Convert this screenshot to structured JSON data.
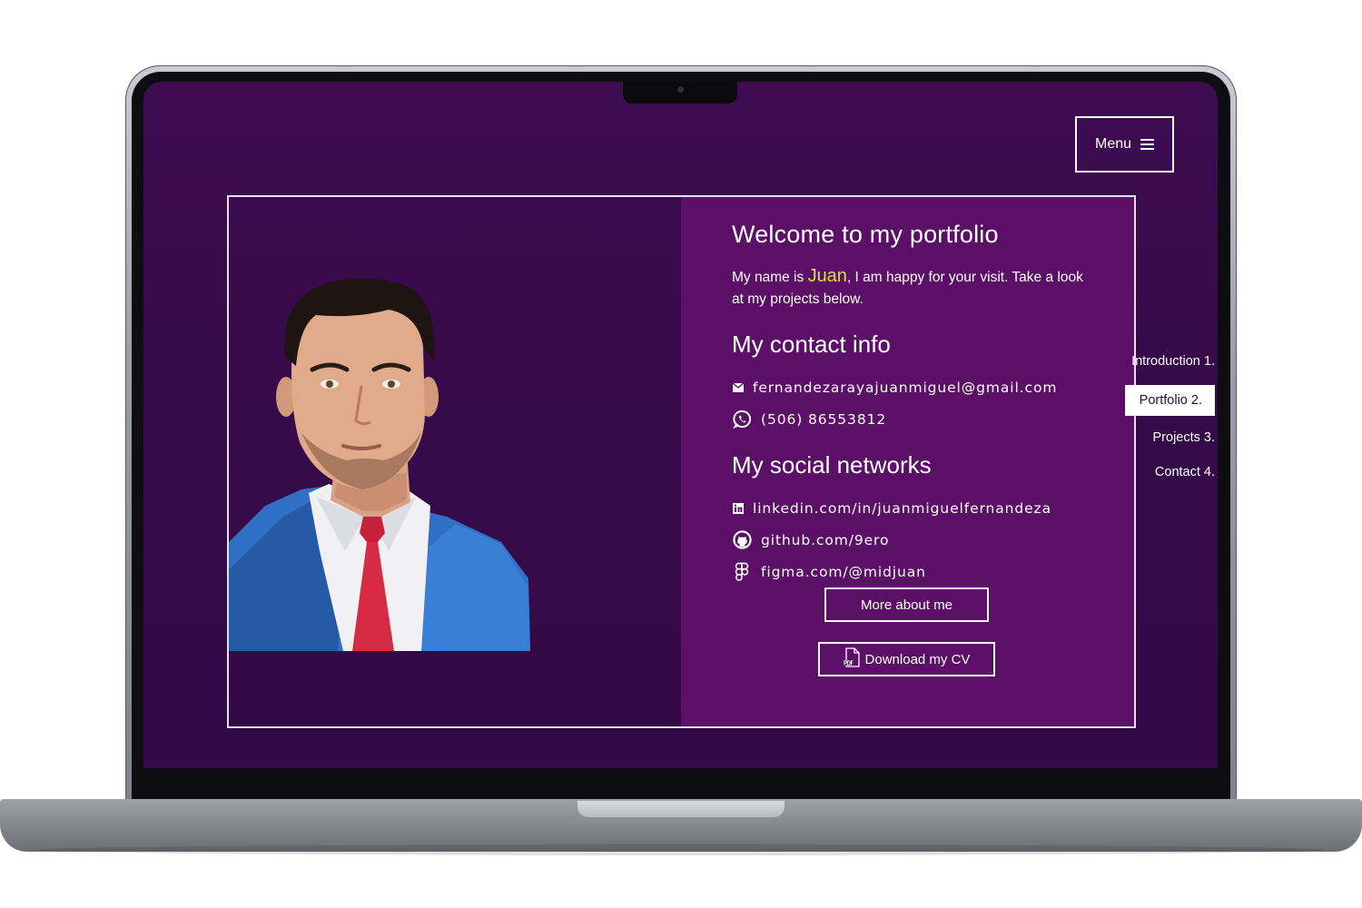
{
  "header": {
    "menu_label": "Menu"
  },
  "intro": {
    "title": "Welcome to my portfolio",
    "text_before": "My name is ",
    "name": "Juan",
    "text_after": ", I am happy for your visit. Take a look at my projects below."
  },
  "contact": {
    "title": "My contact info",
    "email": "fernandezarayajuanmiguel@gmail.com",
    "phone": "(506) 86553812"
  },
  "social": {
    "title": "My social networks",
    "linkedin": "linkedin.com/in/juanmiguelfernandeza",
    "github": "github.com/9ero",
    "figma": "figma.com/@midjuan"
  },
  "buttons": {
    "about": "More about me",
    "cv": "Download my CV"
  },
  "side_nav": [
    {
      "label": "Introduction 1.",
      "active": false
    },
    {
      "label": "Portfolio 2.",
      "active": true
    },
    {
      "label": "Projects 3.",
      "active": false
    },
    {
      "label": "Contact 4.",
      "active": false
    }
  ],
  "colors": {
    "background": "#3f0c52",
    "card_left": "#3a0b4e",
    "card_right": "#5c0f66",
    "name_highlight": "#d6e04a",
    "laptop_silver": "#9a9ea6"
  },
  "icons": {
    "menu": "hamburger-icon",
    "email": "envelope-icon",
    "phone": "whatsapp-icon",
    "linkedin": "linkedin-icon",
    "github": "github-icon",
    "figma": "figma-icon",
    "cv": "pdf-file-icon"
  }
}
